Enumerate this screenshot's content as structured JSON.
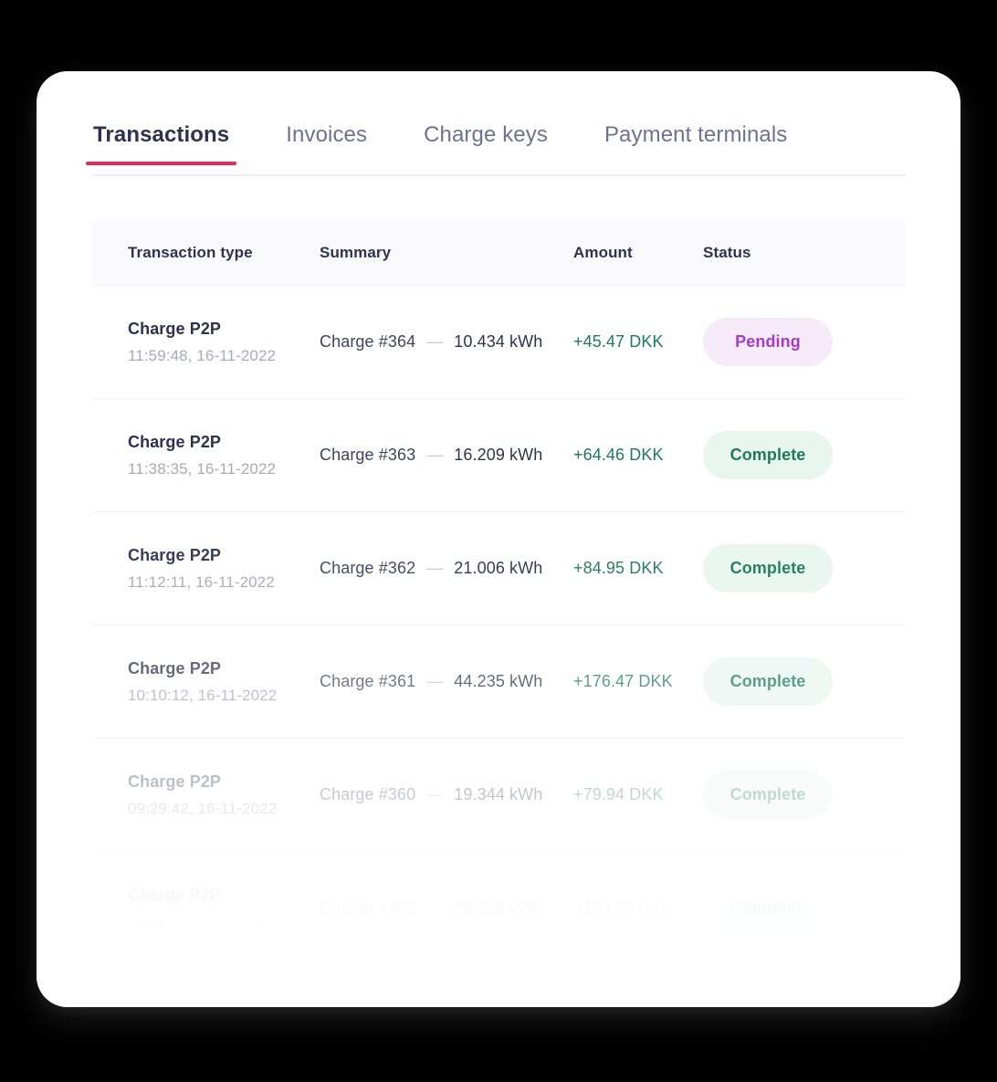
{
  "tabs": [
    {
      "label": "Transactions",
      "active": true
    },
    {
      "label": "Invoices",
      "active": false
    },
    {
      "label": "Charge keys",
      "active": false
    },
    {
      "label": "Payment terminals",
      "active": false
    }
  ],
  "accent_color": "#E82A5B",
  "table": {
    "columns": {
      "type": "Transaction type",
      "summary": "Summary",
      "amount": "Amount",
      "status": "Status"
    },
    "rows": [
      {
        "type": "Charge P2P",
        "timestamp": "11:59:48, 16-11-2022",
        "charge_id": "Charge #364",
        "separator": "—",
        "energy": "10.434 kWh",
        "amount": "+45.47 DKK",
        "status": "Pending",
        "status_kind": "pending",
        "fade": "fade-100"
      },
      {
        "type": "Charge P2P",
        "timestamp": "11:38:35, 16-11-2022",
        "charge_id": "Charge #363",
        "separator": "—",
        "energy": "16.209 kWh",
        "amount": "+64.46 DKK",
        "status": "Complete",
        "status_kind": "complete",
        "fade": "fade-100"
      },
      {
        "type": "Charge P2P",
        "timestamp": "11:12:11, 16-11-2022",
        "charge_id": "Charge #362",
        "separator": "—",
        "energy": "21.006 kWh",
        "amount": "+84.95 DKK",
        "status": "Complete",
        "status_kind": "complete",
        "fade": "fade-95"
      },
      {
        "type": "Charge P2P",
        "timestamp": "10:10:12, 16-11-2022",
        "charge_id": "Charge #361",
        "separator": "—",
        "energy": "44.235 kWh",
        "amount": "+176.47 DKK",
        "status": "Complete",
        "status_kind": "complete",
        "fade": "fade-72"
      },
      {
        "type": "Charge P2P",
        "timestamp": "09:29:42, 16-11-2022",
        "charge_id": "Charge #360",
        "separator": "—",
        "energy": "19.344 kWh",
        "amount": "+79.94 DKK",
        "status": "Complete",
        "status_kind": "complete",
        "fade": "fade-40"
      },
      {
        "type": "Charge P2P",
        "timestamp": "08:11:23, 16-11-2022",
        "charge_id": "Charge #359",
        "separator": "—",
        "energy": "26.256 kWh",
        "amount": "+104.29 DKK",
        "status": "Complete",
        "status_kind": "complete",
        "fade": "fade-12"
      }
    ]
  }
}
